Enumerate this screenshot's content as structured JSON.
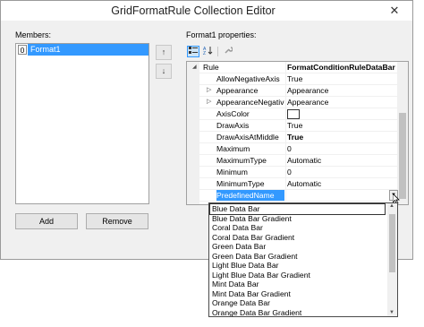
{
  "window": {
    "title": "GridFormatRule Collection Editor",
    "close_glyph": "✕"
  },
  "members": {
    "label": "Members:",
    "items": [
      {
        "index": "0",
        "name": "Format1"
      }
    ],
    "add_label": "Add",
    "remove_label": "Remove",
    "move_up_glyph": "↑",
    "move_down_glyph": "↓"
  },
  "properties": {
    "label": "Format1 properties:",
    "rows": [
      {
        "name": "Rule",
        "value": "FormatConditionRuleDataBar",
        "expander": "◢",
        "bold_name": false,
        "bold_value": true
      },
      {
        "name": "AllowNegativeAxis",
        "value": "True",
        "expander": "",
        "bold_name": false,
        "bold_value": false
      },
      {
        "name": "Appearance",
        "value": "Appearance",
        "expander": "▷",
        "bold_name": false,
        "bold_value": false
      },
      {
        "name": "AppearanceNegative",
        "value": "Appearance",
        "expander": "▷",
        "bold_name": false,
        "bold_value": false
      },
      {
        "name": "AxisColor",
        "value": "",
        "expander": "",
        "bold_name": false,
        "bold_value": false
      },
      {
        "name": "DrawAxis",
        "value": "True",
        "expander": "",
        "bold_name": false,
        "bold_value": false
      },
      {
        "name": "DrawAxisAtMiddle",
        "value": "True",
        "expander": "",
        "bold_name": false,
        "bold_value": true
      },
      {
        "name": "Maximum",
        "value": "0",
        "expander": "",
        "bold_name": false,
        "bold_value": false
      },
      {
        "name": "MaximumType",
        "value": "Automatic",
        "expander": "",
        "bold_name": false,
        "bold_value": false
      },
      {
        "name": "Minimum",
        "value": "0",
        "expander": "",
        "bold_name": false,
        "bold_value": false
      },
      {
        "name": "MinimumType",
        "value": "Automatic",
        "expander": "",
        "bold_name": false,
        "bold_value": false
      },
      {
        "name": "PredefinedName",
        "value": "",
        "expander": "",
        "bold_name": false,
        "bold_value": false
      }
    ],
    "selected_index": 11
  },
  "dropdown": {
    "items": [
      "Blue Data Bar",
      "Blue Data Bar Gradient",
      "Coral Data Bar",
      "Coral Data Bar Gradient",
      "Green Data Bar",
      "Green Data Bar Gradient",
      "Light Blue Data Bar",
      "Light Blue Data Bar Gradient",
      "Mint Data Bar",
      "Mint Data Bar Gradient",
      "Orange Data Bar",
      "Orange Data Bar Gradient"
    ],
    "focused_index": 0,
    "open_glyph": "▼",
    "scroll_up_glyph": "▲",
    "scroll_down_glyph": "▼"
  },
  "colors": {
    "selection": "#3399ff",
    "window_bg": "#f0f0f0"
  }
}
